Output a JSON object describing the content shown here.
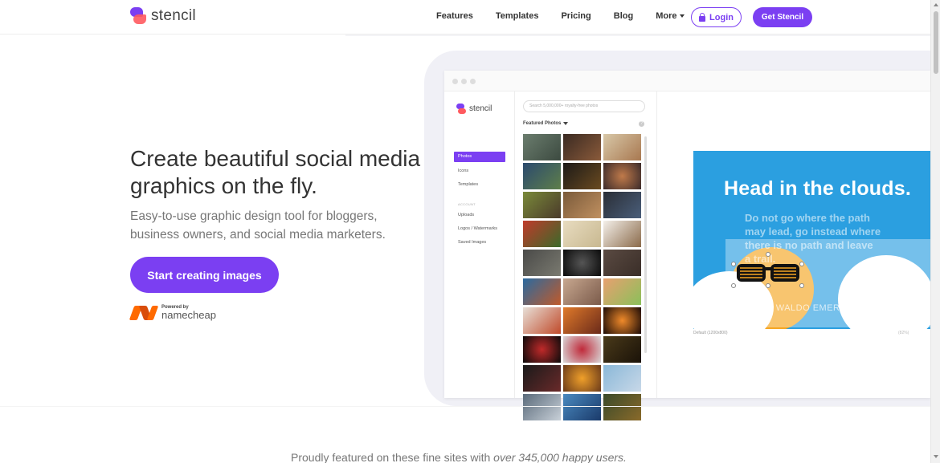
{
  "brand": {
    "name": "stencil"
  },
  "nav": {
    "links": [
      "Features",
      "Templates",
      "Pricing",
      "Blog"
    ],
    "more_label": "More",
    "login_label": "Login",
    "cta_label": "Get Stencil"
  },
  "hero": {
    "headline": "Create beautiful social media graphics on the fly.",
    "subheadline": "Easy-to-use graphic design tool for bloggers, business owners, and social media marketers.",
    "cta_label": "Start creating images",
    "powered_by_label": "Powered by",
    "powered_by_name": "namecheap"
  },
  "app_preview": {
    "logo_text": "stencil",
    "sidebar_items": [
      "Photos",
      "Icons",
      "Templates"
    ],
    "account_section_label": "ACCOUNT",
    "account_items": [
      "Uploads",
      "Logos / Watermarks",
      "Saved Images"
    ],
    "search_placeholder": "Search 5,000,000+ royalty-free photos",
    "featured_label": "Featured Photos",
    "help_glyph": "?",
    "design": {
      "title": "Head in the clouds.",
      "quote": "Do not go where the path may lead, go instead where there is no path and leave a trail.",
      "author": "RALPH WALDO EMERSON"
    },
    "canvas_size_label": "Default (1200x800)",
    "zoom_label": "(82%)"
  },
  "footer_teaser": {
    "prefix": "Proudly featured on these fine sites with ",
    "emphasis": "over 345,000 happy users."
  },
  "colors": {
    "brand_purple": "#7b3ff2",
    "brand_red": "#ff5a5f",
    "namecheap_orange": "#ff6a00",
    "design_blue": "#2b9fe0"
  }
}
